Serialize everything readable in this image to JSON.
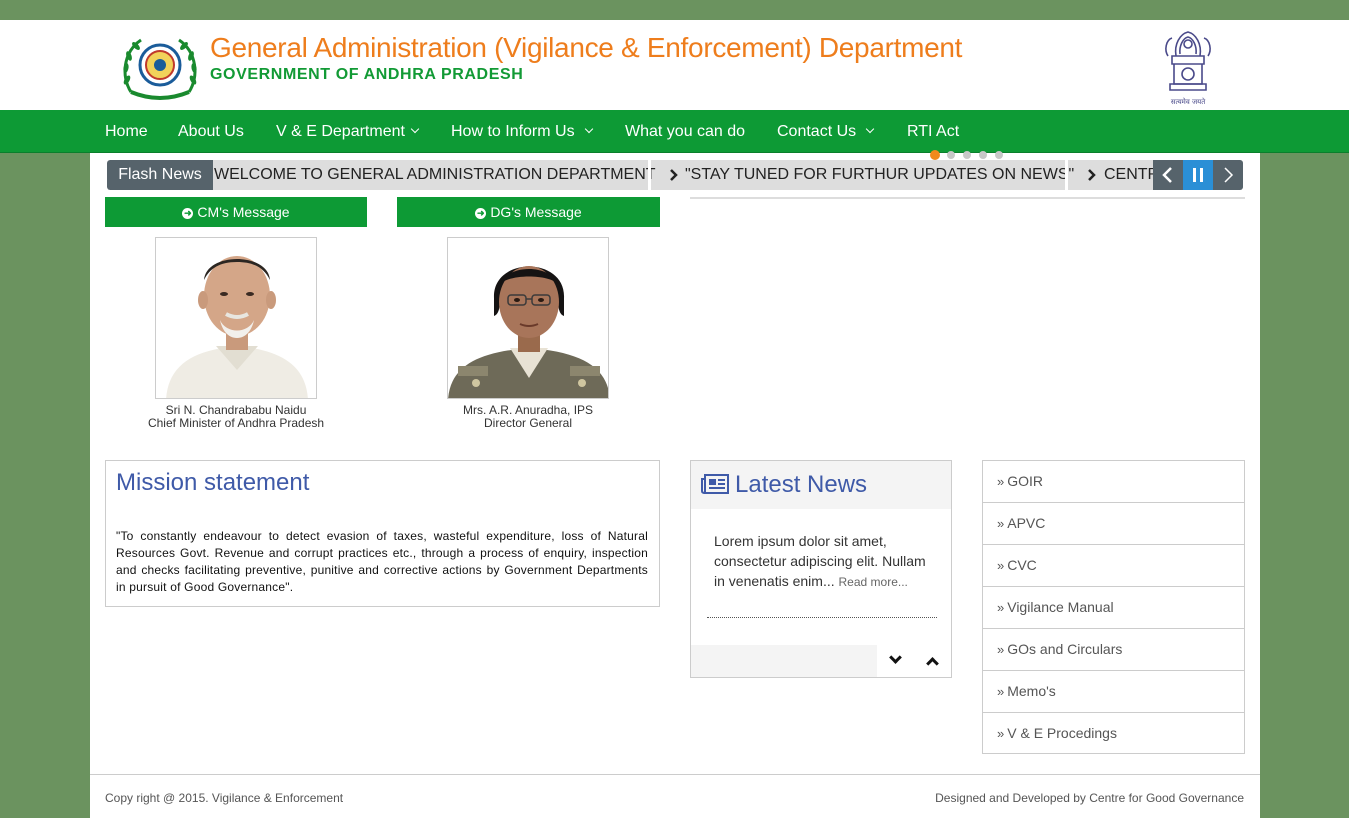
{
  "header": {
    "title": "General Administration (Vigilance & Enforcement) Department",
    "subtitle": "GOVERNMENT OF ANDHRA PRADESH",
    "logo_icon": "ap-state-logo-icon",
    "emblem_icon": "national-emblem-icon",
    "emblem_caption": "सत्यमेव जयते"
  },
  "nav": {
    "items": [
      {
        "label": "Home"
      },
      {
        "label": "About Us"
      },
      {
        "label": "V & E Department"
      },
      {
        "label": "How to Inform Us"
      },
      {
        "label": "What you can do"
      },
      {
        "label": "Contact Us"
      },
      {
        "label": "RTI Act"
      }
    ]
  },
  "ticker": {
    "label": "Flash News",
    "items": [
      "WELCOME TO GENERAL ADMINISTRATION DEPARTMENT",
      "\"STAY TUNED FOR FURTHUR UPDATES ON NEWS\"",
      "CENTR"
    ],
    "prev": "‹",
    "pause": "II",
    "next": "›"
  },
  "messages": {
    "cm_button": "CM's Message",
    "dg_button": "DG's Message",
    "cm_name": "Sri N. Chandrababu Naidu",
    "cm_title": "Chief Minister of Andhra Pradesh",
    "dg_name": "Mrs. A.R. Anuradha, IPS",
    "dg_title": "Director General"
  },
  "mission": {
    "heading": "Mission statement",
    "text": "\"To constantly endeavour to detect evasion of taxes, wasteful expenditure, loss of Natural Resources Govt. Revenue and corrupt practices etc., through a process of enquiry, inspection and checks facilitating preventive, punitive and corrective actions by Government Departments in pursuit of Good Governance\"."
  },
  "news": {
    "heading": "Latest News",
    "body": "Lorem ipsum dolor sit amet, consectetur adipiscing elit. Nullam in venenatis enim...",
    "read_more": "Read more..."
  },
  "links": {
    "items": [
      {
        "label": "GOIR"
      },
      {
        "label": "APVC"
      },
      {
        "label": "CVC"
      },
      {
        "label": "Vigilance Manual"
      },
      {
        "label": "GOs and Circulars"
      },
      {
        "label": "Memo's"
      },
      {
        "label": "V & E Procedings"
      }
    ]
  },
  "footer": {
    "copyright": "Copy right @ 2015. Vigilance & Enforcement",
    "credits": "Designed and Developed by Centre for Good Governance"
  },
  "colors": {
    "primary_green": "#0d9a35",
    "title_orange": "#ee7d1c",
    "heading_blue": "#3f5aa8",
    "background": "#6b935f"
  }
}
